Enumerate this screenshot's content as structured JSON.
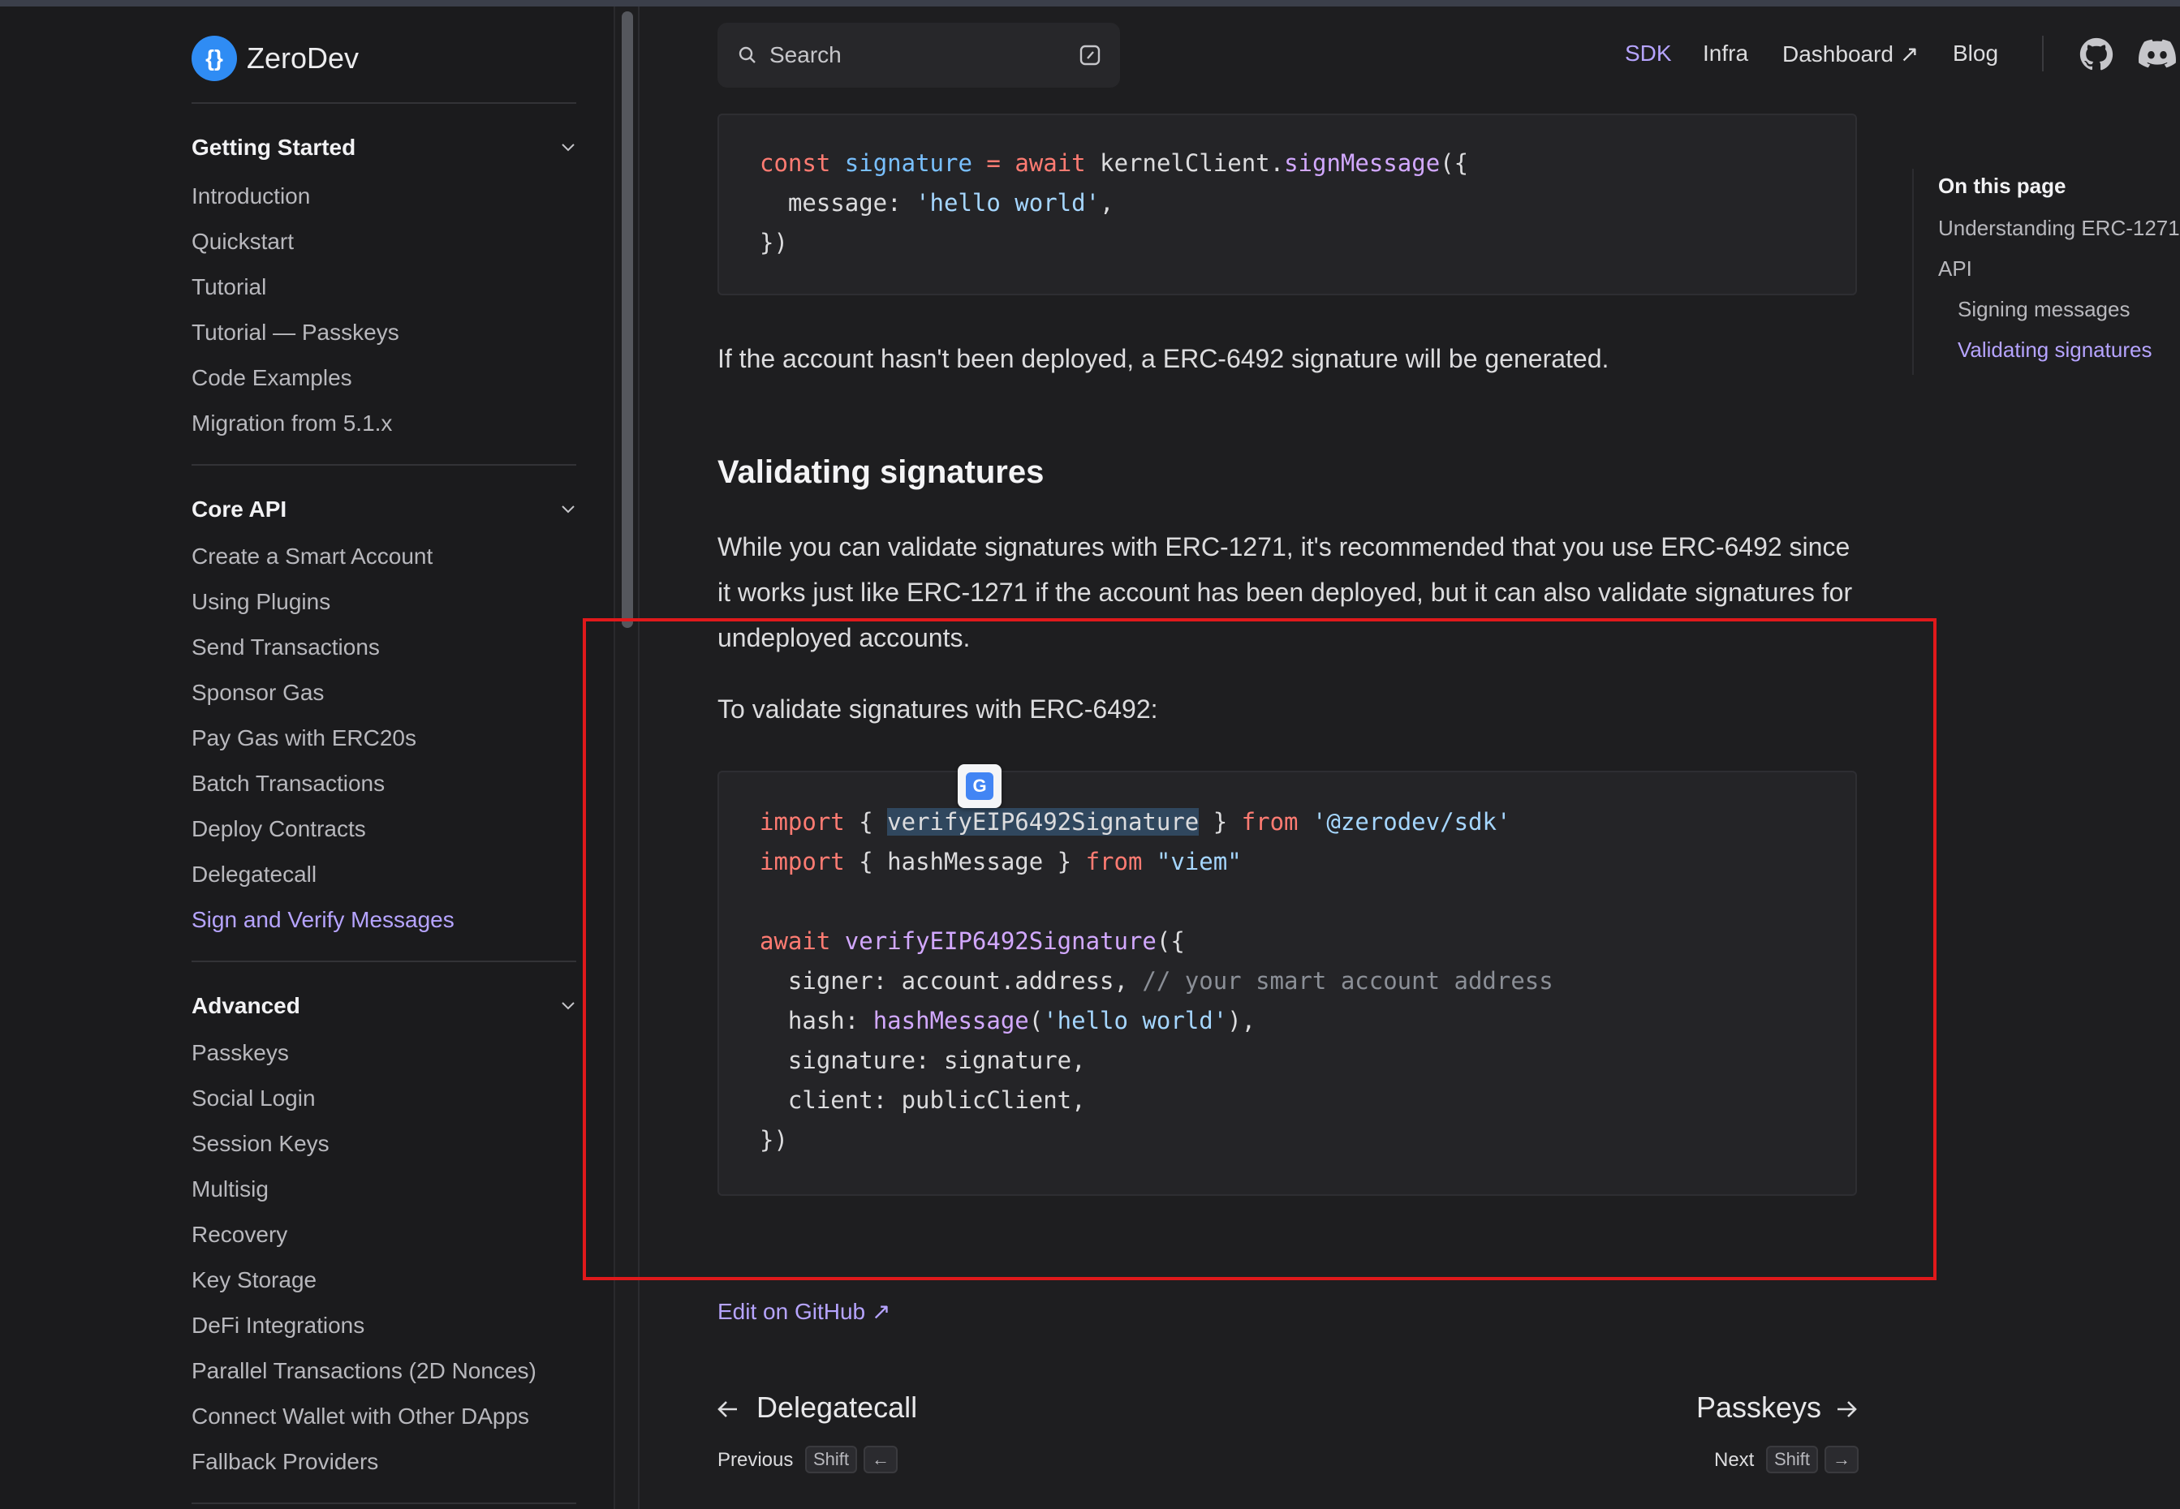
{
  "header": {
    "search_placeholder": "Search",
    "nav": [
      {
        "label": "SDK",
        "active": true
      },
      {
        "label": "Infra",
        "active": false
      },
      {
        "label": "Dashboard ↗",
        "active": false
      },
      {
        "label": "Blog",
        "active": false
      }
    ]
  },
  "sidebar": {
    "brand": "ZeroDev",
    "sections": [
      {
        "title": "Getting Started",
        "items": [
          "Introduction",
          "Quickstart",
          "Tutorial",
          "Tutorial — Passkeys",
          "Code Examples",
          "Migration from 5.1.x"
        ]
      },
      {
        "title": "Core API",
        "items": [
          "Create a Smart Account",
          "Using Plugins",
          "Send Transactions",
          "Sponsor Gas",
          "Pay Gas with ERC20s",
          "Batch Transactions",
          "Deploy Contracts",
          "Delegatecall",
          "Sign and Verify Messages"
        ]
      },
      {
        "title": "Advanced",
        "items": [
          "Passkeys",
          "Social Login",
          "Session Keys",
          "Multisig",
          "Recovery",
          "Key Storage",
          "DeFi Integrations",
          "Parallel Transactions (2D Nonces)",
          "Connect Wallet with Other DApps",
          "Fallback Providers"
        ]
      }
    ],
    "active_item": "Sign and Verify Messages"
  },
  "content": {
    "code1": {
      "l1": {
        "a": "const",
        "b": "signature",
        "c": "=",
        "d": "await",
        "e": "kernelClient.",
        "f": "signMessage",
        "g": "({"
      },
      "l2": {
        "a": "  message: ",
        "b": "'hello world'",
        "c": ","
      },
      "l3": "})"
    },
    "deploy_note": "If the account hasn't been deployed, a ERC-6492 signature will be generated.",
    "heading": "Validating signatures",
    "para1": "While you can validate signatures with ERC-1271, it's recommended that you use ERC-6492 since it works just like ERC-1271 if the account has been deployed, but it can also validate signatures for undeployed accounts.",
    "para2": "To validate signatures with ERC-6492:",
    "code2": {
      "l1": {
        "a": "import",
        "b": " { ",
        "c": "verifyEIP6492Signature",
        "d": " } ",
        "e": "from",
        "f": "'@zerodev/sdk'"
      },
      "l2": {
        "a": "import",
        "b": " { hashMessage } ",
        "c": "from",
        "d": "\"viem\""
      },
      "l4": {
        "a": "await",
        "b": "verifyEIP6492Signature",
        "c": "({"
      },
      "l5": {
        "a": "  signer: account.address, ",
        "b": "// your smart account address"
      },
      "l6": {
        "a": "  hash: ",
        "b": "hashMessage",
        "c": "(",
        "d": "'hello world'",
        "e": "),"
      },
      "l7": "  signature: signature,",
      "l8": "  client: publicClient,",
      "l9": "})"
    },
    "edit_link": "Edit on GitHub ↗",
    "pager": {
      "prev_title": "Delegatecall",
      "prev_label": "Previous",
      "next_title": "Passkeys",
      "next_label": "Next",
      "shift": "Shift",
      "left_arrow": "←",
      "right_arrow": "→"
    },
    "translate_badge": "G"
  },
  "toc": {
    "title": "On this page",
    "items": [
      {
        "label": "Understanding ERC-1271",
        "active": false
      },
      {
        "label": "API",
        "active": false
      },
      {
        "label": "Signing messages",
        "active": false
      },
      {
        "label": "Validating signatures",
        "active": true
      }
    ]
  },
  "colors": {
    "accent": "#b6a4ff",
    "background": "#1e1e20",
    "highlight_box": "#e0191b"
  }
}
